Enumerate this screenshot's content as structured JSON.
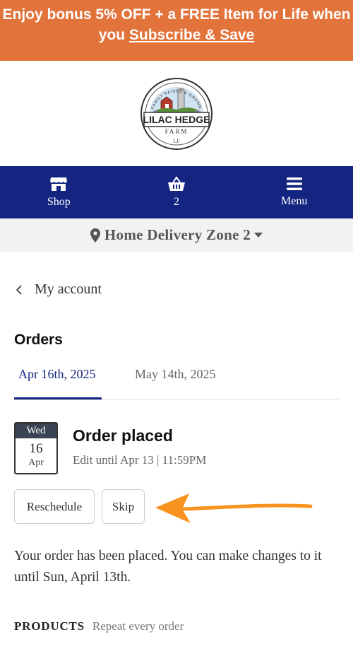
{
  "promo": {
    "line1": "Enjoy bonus 5% OFF + a FREE Item for Life when",
    "line2_prefix": "you ",
    "line2_link": "Subscribe & Save",
    "background": "#e2733a"
  },
  "logo": {
    "top_text": "FAMILY RAISED & GROWN",
    "name": "LILAC HEDGE",
    "sub": "FARM",
    "monogram": "LF"
  },
  "nav": {
    "background": "#132580",
    "items": [
      {
        "label": "Shop",
        "icon": "store-icon"
      },
      {
        "label": "2",
        "icon": "basket-icon"
      },
      {
        "label": "Menu",
        "icon": "hamburger-icon"
      }
    ]
  },
  "zone": {
    "label": "Home Delivery Zone 2"
  },
  "back": {
    "label": "My account"
  },
  "orders": {
    "title": "Orders",
    "tabs": [
      {
        "label": "Apr 16th, 2025",
        "active": true
      },
      {
        "label": "May 14th, 2025",
        "active": false
      }
    ]
  },
  "order": {
    "calendar": {
      "weekday": "Wed",
      "day": "16",
      "month": "Apr"
    },
    "status_title": "Order placed",
    "status_sub": "Edit until Apr 13 | 11:59PM",
    "buttons": {
      "reschedule": "Reschedule",
      "skip": "Skip"
    },
    "message": "Your order has been placed. You can make changes to it until Sun, April 13th.",
    "arrow_color": "#f7931e"
  },
  "products": {
    "label": "PRODUCTS",
    "repeat_link": "Repeat every order"
  }
}
